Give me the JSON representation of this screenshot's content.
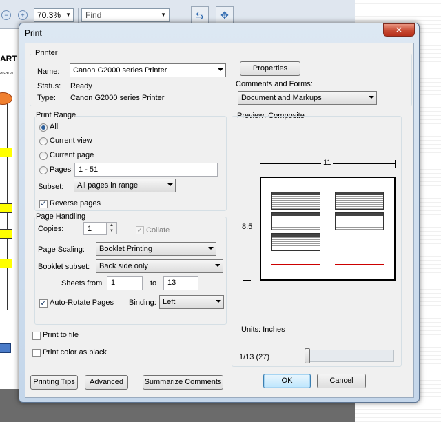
{
  "app": {
    "zoom": "70.3%",
    "find_placeholder": "Find",
    "doc_heading_fragment": "ART",
    "doc_small_fragment": "asana"
  },
  "dialog": {
    "title": "Print",
    "close_glyph": "✕",
    "printer": {
      "group_label": "Printer",
      "name_label": "Name:",
      "name_value": "Canon G2000 series Printer",
      "status_label": "Status:",
      "status_value": "Ready",
      "type_label": "Type:",
      "type_value": "Canon G2000 series Printer",
      "properties_button": "Properties",
      "comments_label": "Comments and Forms:",
      "comments_value": "Document and Markups"
    },
    "print_range": {
      "group_label": "Print Range",
      "options": [
        {
          "label": "All",
          "selected": true
        },
        {
          "label": "Current view",
          "selected": false
        },
        {
          "label": "Current page",
          "selected": false
        },
        {
          "label": "Pages",
          "selected": false
        }
      ],
      "pages_value": "1 - 51",
      "subset_label": "Subset:",
      "subset_value": "All pages in range",
      "reverse_label": "Reverse pages",
      "reverse_checked": true
    },
    "page_handling": {
      "group_label": "Page Handling",
      "copies_label": "Copies:",
      "copies_value": "1",
      "collate_label": "Collate",
      "scaling_label": "Page Scaling:",
      "scaling_value": "Booklet Printing",
      "booklet_label": "Booklet subset:",
      "booklet_value": "Back side only",
      "sheets_label": "Sheets from",
      "sheets_from": "1",
      "to_label": "to",
      "sheets_to": "13",
      "autorotate_label": "Auto-Rotate Pages",
      "autorotate_checked": true,
      "binding_label": "Binding:",
      "binding_value": "Left"
    },
    "print_to_file_label": "Print to file",
    "print_color_black_label": "Print color as black",
    "preview": {
      "label": "Preview: Composite",
      "width_value": "11",
      "height_value": "8.5",
      "units_label": "Units: Inches",
      "page_counter": "1/13 (27)"
    },
    "buttons": {
      "printing_tips": "Printing Tips",
      "advanced": "Advanced",
      "summarize": "Summarize Comments",
      "ok": "OK",
      "cancel": "Cancel"
    }
  },
  "icons": {
    "close": "close-icon",
    "radio": "radio-button",
    "check": "checkmark-icon"
  }
}
